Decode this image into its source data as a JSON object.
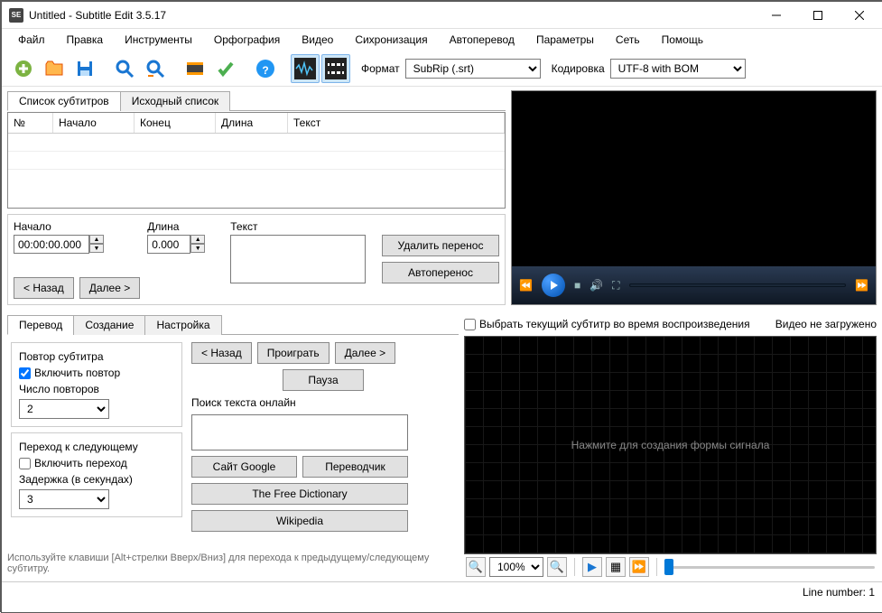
{
  "window": {
    "title": "Untitled - Subtitle Edit 3.5.17"
  },
  "menu": [
    "Файл",
    "Правка",
    "Инструменты",
    "Орфография",
    "Видео",
    "Сихронизация",
    "Автоперевод",
    "Параметры",
    "Сеть",
    "Помощь"
  ],
  "toolbar": {
    "format_label": "Формат",
    "format_value": "SubRip (.srt)",
    "encoding_label": "Кодировка",
    "encoding_value": "UTF-8 with BOM"
  },
  "top_tabs": {
    "list": "Список субтитров",
    "source": "Исходный список"
  },
  "grid": {
    "cols": [
      "№",
      "Начало",
      "Конец",
      "Длина",
      "Текст"
    ]
  },
  "edit": {
    "start_label": "Начало",
    "start_value": "00:00:00.000",
    "duration_label": "Длина",
    "duration_value": "0.000",
    "text_label": "Текст",
    "remove_break": "Удалить перенос",
    "auto_break": "Автоперенос",
    "prev": "< Назад",
    "next": "Далее >"
  },
  "select_current": "Выбрать текущий субтитр во время воспроизведения",
  "video_not_loaded": "Видео не загружено",
  "bottom_tabs": [
    "Перевод",
    "Создание",
    "Настройка"
  ],
  "repeat": {
    "group": "Повтор субтитра",
    "enable": "Включить повтор",
    "count_label": "Число повторов",
    "count_value": "2"
  },
  "goto": {
    "group": "Переход к следующему",
    "enable": "Включить переход",
    "delay_label": "Задержка (в секундах)",
    "delay_value": "3"
  },
  "play_ctrl": {
    "prev": "< Назад",
    "play": "Проиграть",
    "next": "Далее >",
    "pause": "Пауза"
  },
  "search": {
    "label": "Поиск текста онлайн",
    "google": "Сайт Google",
    "translator": "Переводчик",
    "tfd": "The Free Dictionary",
    "wiki": "Wikipedia"
  },
  "hint": "Используйте клавиши [Alt+стрелки Вверх/Вниз] для перехода к предыдущему/следующему субтитру.",
  "waveform_hint": "Нажмите для создания формы сигнала",
  "zoom": "100%",
  "status": "Line number: 1"
}
